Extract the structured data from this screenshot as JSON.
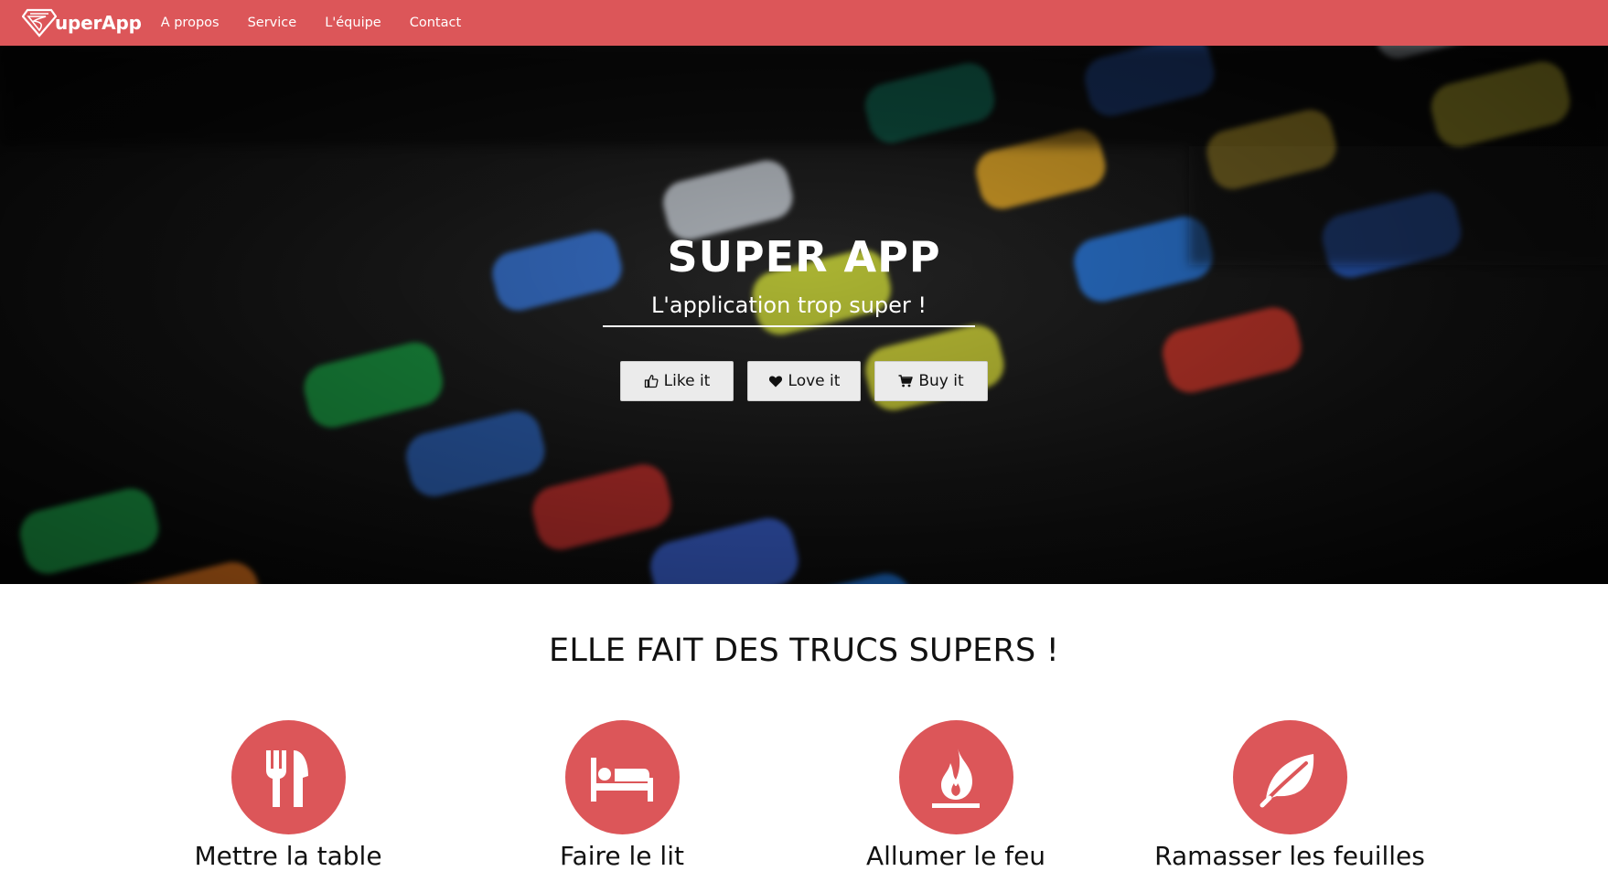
{
  "colors": {
    "brand": "#dc5659",
    "button_bg": "#ebebeb",
    "hero_text": "#ffffff"
  },
  "navbar": {
    "brand_text": "uperApp",
    "links": [
      "A propos",
      "Service",
      "L'équipe",
      "Contact"
    ]
  },
  "hero": {
    "title": "SUPER APP",
    "subtitle": "L'application trop super !",
    "buttons": [
      {
        "label": "Like it",
        "icon": "thumbs-up-icon"
      },
      {
        "label": "Love it",
        "icon": "heart-icon"
      },
      {
        "label": "Buy it",
        "icon": "cart-icon"
      }
    ]
  },
  "features": {
    "title": "ELLE FAIT DES TRUCS SUPERS !",
    "items": [
      {
        "title": "Mettre la table",
        "icon": "cutlery-icon"
      },
      {
        "title": "Faire le lit",
        "icon": "bed-icon"
      },
      {
        "title": "Allumer le feu",
        "icon": "fire-icon"
      },
      {
        "title": "Ramasser les feuilles",
        "icon": "leaf-icon"
      }
    ]
  }
}
